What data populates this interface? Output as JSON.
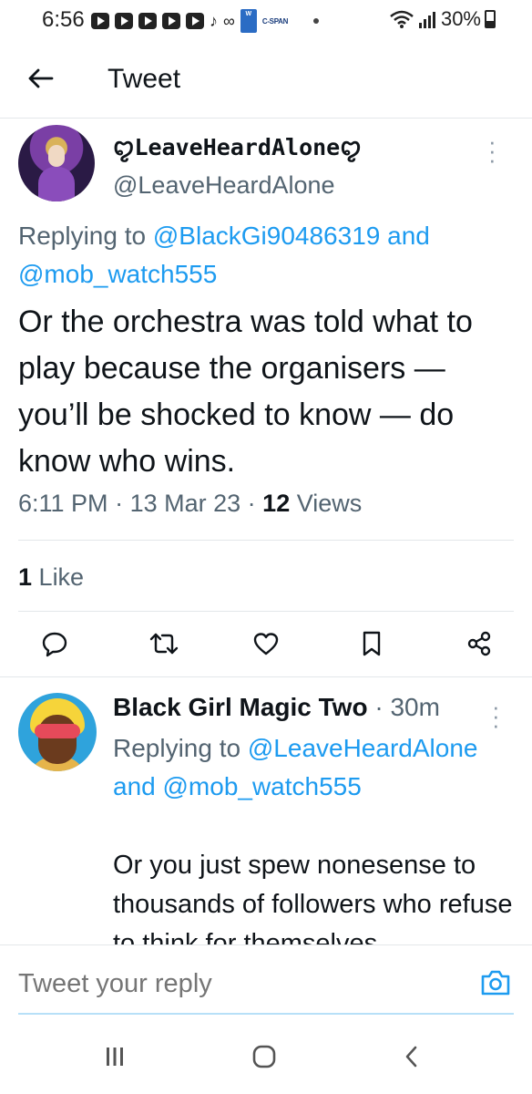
{
  "status_bar": {
    "time": "6:56",
    "battery": "30%",
    "doc_icon_label": "W",
    "cspan_label": "C-SPAN"
  },
  "header": {
    "title": "Tweet"
  },
  "main_tweet": {
    "display_name": "ꨄLeaveHeardAloneꨄ",
    "handle": "@LeaveHeardAlone",
    "replying_prefix": "Replying to ",
    "replying_user1": "@BlackGi90486319",
    "replying_and": " and ",
    "replying_user2": "@mob_watch555",
    "text": "Or the orchestra was told what to play because the organisers — you’ll be shocked to know — do know who wins.",
    "time": "6:11 PM",
    "date": "13 Mar 23",
    "views_count": "12",
    "views_label": "Views",
    "likes_count": "1",
    "likes_label": "Like"
  },
  "reply_tweet": {
    "display_name": "Black Girl Magic Two",
    "age": "30m",
    "replying_prefix": "Replying to ",
    "replying_user1": "@LeaveHeardAlone",
    "replying_and": " and ",
    "replying_user2": "@mob_watch555",
    "text": "Or you just spew nonesense to thousands of followers who refuse to think for themselves."
  },
  "reply_box": {
    "placeholder": "Tweet your reply"
  },
  "colors": {
    "link": "#1d9bf0",
    "text": "#0f1419",
    "secondary": "#536471"
  }
}
